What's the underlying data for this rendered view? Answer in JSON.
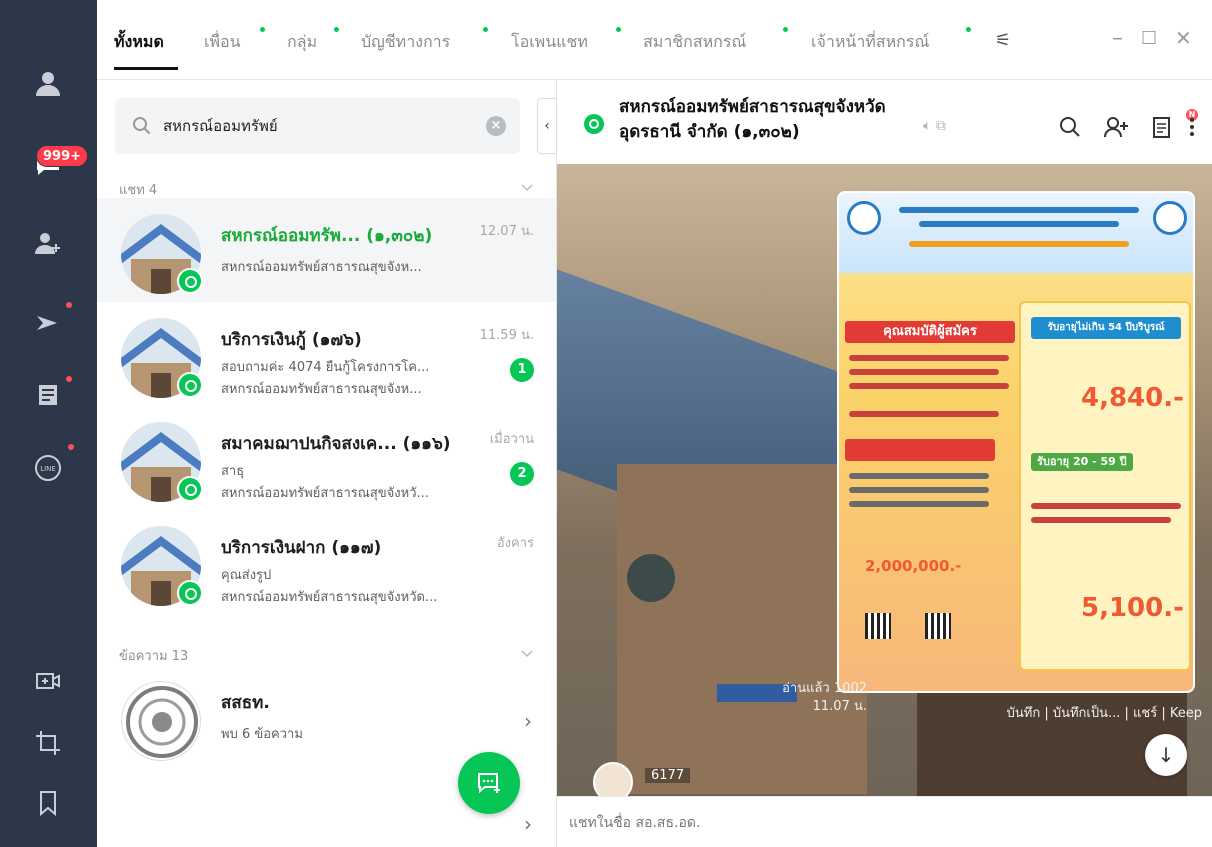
{
  "rail": {
    "badge": "999+"
  },
  "tabs": {
    "all": "ทั้งหมด",
    "friends": "เพื่อน",
    "groups": "กลุ่ม",
    "official": "บัญชีทางการ",
    "openchat": "โอเพนแชท",
    "members": "สมาชิกสหกรณ์",
    "staff": "เจ้าหน้าที่สหกรณ์",
    "accent": "#06c755"
  },
  "search": {
    "value": "สหกรณ์ออมทรัพย์"
  },
  "sections": {
    "chats": "แชท 4",
    "messages": "ข้อความ 13"
  },
  "chats": [
    {
      "title": "สหกรณ์ออมทรัพ... (๑,๓๐๒)",
      "line1": "สหกรณ์ออมทรัพย์สาธารณสุขจังห...",
      "time": "12.07 น."
    },
    {
      "title": "บริการเงินกู้ (๑๗๖)",
      "line1": "สอบถามค่ะ 4074 ยืนกู้โครงการโค...",
      "line2": "สหกรณ์ออมทรัพย์สาธารณสุขจังห...",
      "time": "11.59 น.",
      "unread": "1"
    },
    {
      "title": "สมาคมฌาปนกิจสงเค... (๑๑๖)",
      "line1": "สาธุ",
      "line2": "สหกรณ์ออมทรัพย์สาธารณสุขจังหวั...",
      "time": "เมื่อวาน",
      "unread": "2"
    },
    {
      "title": "บริการเงินฝาก (๑๑๗)",
      "line1": "คุณส่งรูป",
      "line2": "สหกรณ์ออมทรัพย์สาธารณสุขจังหวัด...",
      "time": "อังคาร"
    }
  ],
  "messages": [
    {
      "title": "สสธท.",
      "line1": "พบ 6 ข้อความ"
    }
  ],
  "chat": {
    "title": "สหกรณ์ออมทรัพย์สาธารณสุขจังหวัดอุดรธานี จำกัด (๑,๓๐๒)",
    "read": "อ่านแล้ว 1002",
    "time": "11.07 น.",
    "actions": "บันทึก | บันทึกเป็น... | แชร์ | Keep",
    "sender_count": "6177",
    "input_placeholder": "แชทในชื่อ สอ.สธ.อด.",
    "notif_badge": "N"
  },
  "poster": {
    "qualify": "คุณสมบัติผู้สมัคร",
    "amount1": "4,840.-",
    "amount2": "5,100.-",
    "coverage": "2,000,000.-",
    "age_range1": "รับอายุไม่เกิน 54 ปีบริบูรณ์",
    "age_range2": "รับอายุ 20 - 59 ปี"
  },
  "icons": [
    "person-icon",
    "chat-icon",
    "add-friend-icon",
    "voom-icon",
    "news-icon",
    "line-icon",
    "video-icon",
    "crop-icon",
    "bookmark-icon",
    "search-icon",
    "add-member-icon",
    "notes-icon",
    "more-icon",
    "mute-icon",
    "new-chat-icon"
  ]
}
